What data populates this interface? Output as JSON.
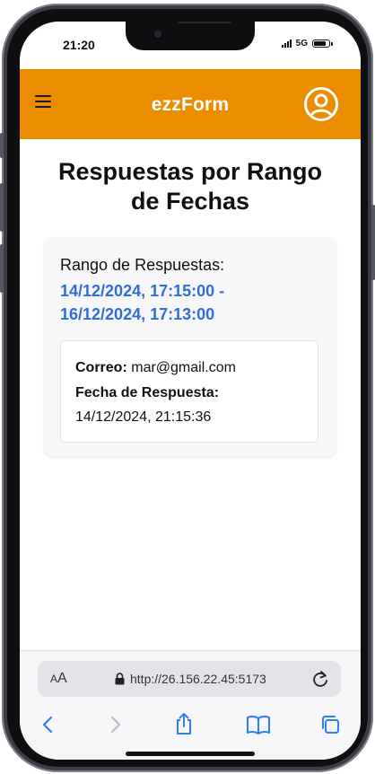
{
  "status_bar": {
    "time": "21:20",
    "network": "5G",
    "battery_level": 0.9
  },
  "header": {
    "brand": "ezzForm",
    "accent_color": "#ea8d00",
    "menu_icon": "hamburger-menu-icon",
    "user_icon": "user-circle-icon"
  },
  "page": {
    "title": "Respuestas por Rango de Fechas"
  },
  "range_card": {
    "label": "Rango de Respuestas:",
    "value": "14/12/2024, 17:15:00 - 16/12/2024, 17:13:00",
    "value_color": "#2f6ed8"
  },
  "responses": [
    {
      "email_label": "Correo:",
      "email": "mar@gmail.com",
      "date_label": "Fecha de Respuesta:",
      "date": "14/12/2024, 21:15:36"
    }
  ],
  "browser": {
    "text_size_label_big": "A",
    "text_size_label_small": "A",
    "url": "http://26.156.22.45:5173",
    "icons": [
      "lock-icon",
      "reload-icon",
      "back-icon",
      "forward-icon",
      "share-icon",
      "bookmarks-icon",
      "tabs-icon"
    ]
  }
}
